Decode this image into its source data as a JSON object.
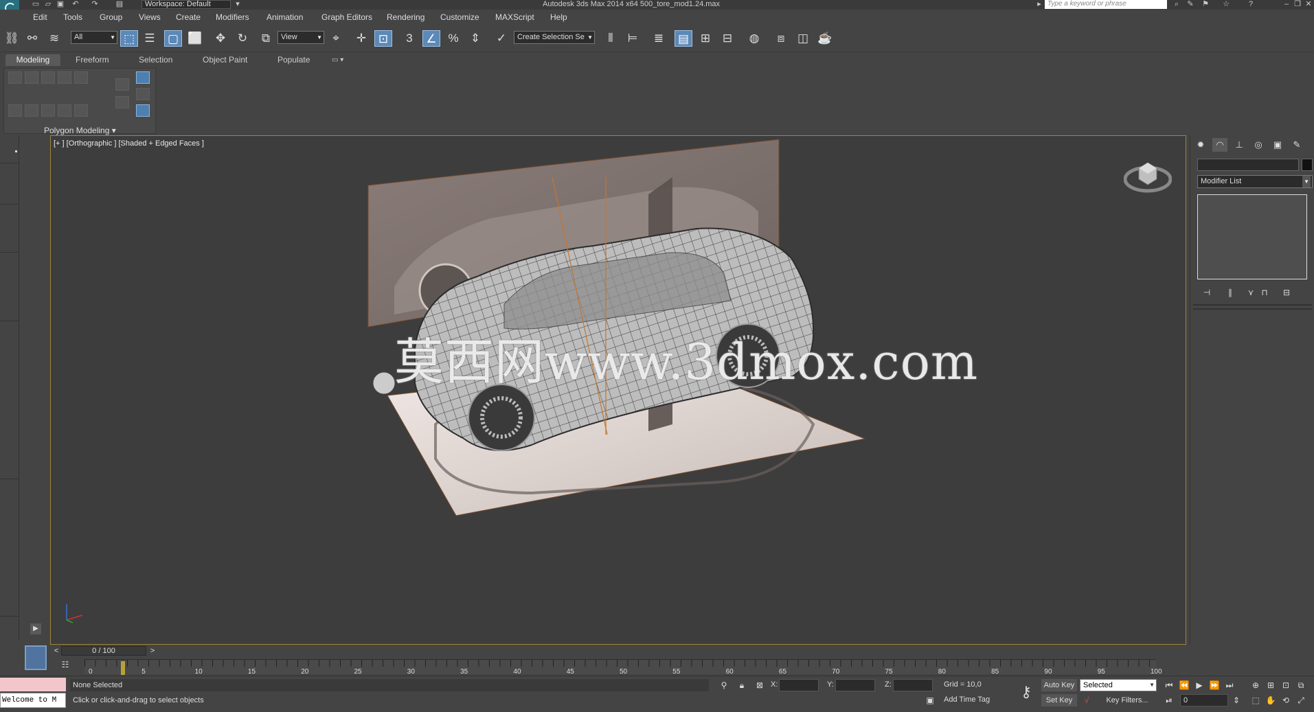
{
  "titlebar": {
    "workspace_label": "Workspace: Default",
    "app_title": "Autodesk 3ds Max  2014 x64       500_tore_mod1.24.max",
    "search_placeholder": "Type a keyword or phrase"
  },
  "menu": [
    "Edit",
    "Tools",
    "Group",
    "Views",
    "Create",
    "Modifiers",
    "Animation",
    "Graph Editors",
    "Rendering",
    "Customize",
    "MAXScript",
    "Help"
  ],
  "toolbar": {
    "selection_filter": "All",
    "ref_coord": "View",
    "snap_3": "3",
    "named_selection_placeholder": "Create Selection Se"
  },
  "ribbon": {
    "tabs": [
      "Modeling",
      "Freeform",
      "Selection",
      "Object Paint",
      "Populate"
    ],
    "active_tab": "Modeling",
    "group_label": "Polygon Modeling"
  },
  "viewport": {
    "label": "[+ ] [Orthographic ] [Shaded + Edged Faces ]",
    "watermark": "莫西网www.3dmox.com"
  },
  "command_panel": {
    "modifier_list": "Modifier List"
  },
  "timeline": {
    "frame_range": "0 / 100",
    "prev": "<",
    "next": ">",
    "ticks": [
      "0",
      "5",
      "10",
      "15",
      "20",
      "25",
      "30",
      "35",
      "40",
      "45",
      "50",
      "55",
      "60",
      "65",
      "70",
      "75",
      "80",
      "85",
      "90",
      "95",
      "100"
    ]
  },
  "status": {
    "listener": "Welcome to M",
    "selection": "None Selected",
    "prompt": "Click or click-and-drag to select objects",
    "x_label": "X:",
    "y_label": "Y:",
    "z_label": "Z:",
    "grid": "Grid = 10,0",
    "add_time_tag": "Add Time Tag",
    "auto_key": "Auto Key",
    "set_key": "Set Key",
    "selected_dd": "Selected",
    "key_filters": "Key Filters...",
    "current_frame": "0"
  },
  "colors": {
    "viewport_border": "#a0853c",
    "active_tool": "#5b89b8",
    "app_logo": "#2a6f7d"
  }
}
